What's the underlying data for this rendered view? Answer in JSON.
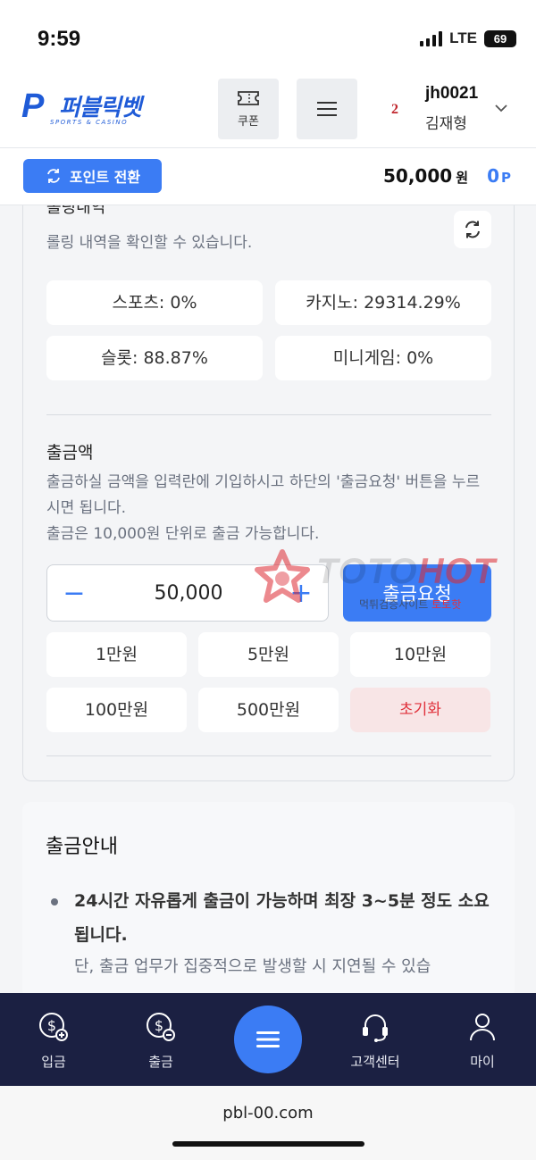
{
  "status": {
    "time": "9:59",
    "network": "LTE",
    "battery": "69"
  },
  "header": {
    "logo_text": "퍼블릭벳",
    "logo_sub": "SPORTS & CASINO",
    "coupon_label": "쿠폰",
    "user": {
      "rank": "2",
      "id": "jh0021",
      "name": "김재형"
    }
  },
  "pointbar": {
    "convert_label": "포인트 전환",
    "balance": "50,000",
    "balance_unit": "원",
    "points": "0",
    "points_unit": "P"
  },
  "rolling": {
    "title": "롤링내역",
    "desc": "롤링 내역을 확인할 수 있습니다.",
    "stats": [
      "스포츠: 0%",
      "카지노: 29314.29%",
      "슬롯: 88.87%",
      "미니게임: 0%"
    ]
  },
  "withdraw": {
    "title": "출금액",
    "desc_line1": "출금하실 금액을 입력란에 기입하시고 하단의 '출금요청' 버튼을 누르시면 됩니다.",
    "desc_line2": "출금은 10,000원 단위로 출금 가능합니다.",
    "amount": "50,000",
    "minus": "−",
    "plus": "+",
    "request_label": "출금요청",
    "quick": [
      "1만원",
      "5만원",
      "10만원",
      "100만원",
      "500만원"
    ],
    "reset_label": "초기화"
  },
  "guide": {
    "title": "출금안내",
    "bullet1": "24시간 자유롭게 출금이 가능하며 최장 3~5분 정도 소요됩니다.",
    "sub1": "단, 출금 업무가 집중적으로 발생할 시 지연될 수 있습"
  },
  "watermark": {
    "main": "TOTO",
    "hot": "HOT",
    "sub": "먹튀검증사이트",
    "sub_hot": "토토핫"
  },
  "tabbar": {
    "deposit": "입금",
    "withdraw": "출금",
    "support": "고객센터",
    "my": "마이"
  },
  "browser": {
    "url": "pbl-00.com"
  },
  "colors": {
    "accent": "#3b7cf4",
    "nav_bg": "#1b2042",
    "danger": "#e0303a"
  }
}
